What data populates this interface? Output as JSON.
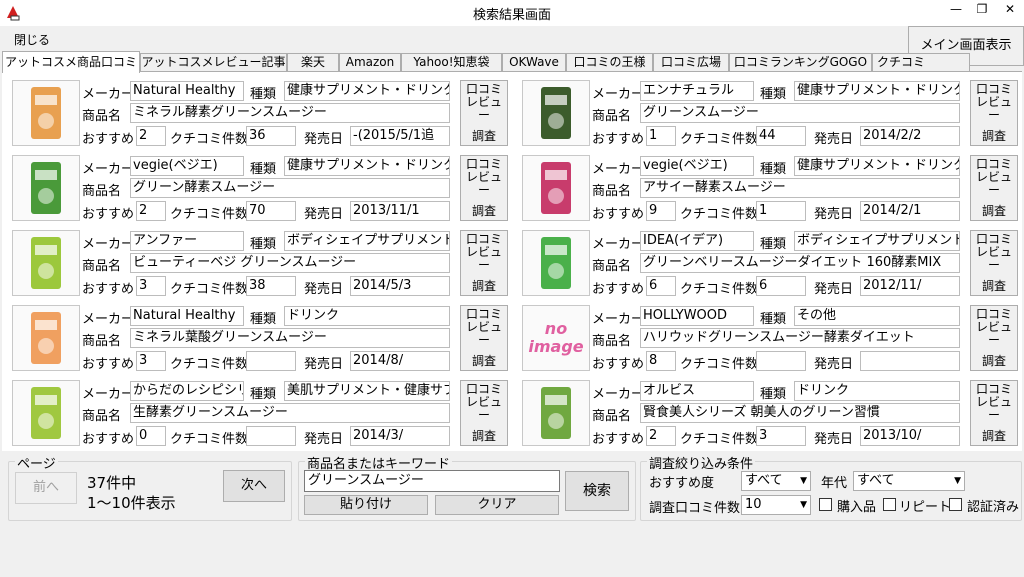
{
  "window": {
    "title": "検索結果画面"
  },
  "menu": {
    "close": "閉じる"
  },
  "main_screen_button": "メイン画面表示",
  "tabs": [
    "アットコスメ商品口コミ",
    "アットコスメレビュー記事",
    "楽天",
    "Amazon",
    "Yahoo!知恵袋",
    "OKWave",
    "口コミの王様",
    "口コミ広場",
    "口コミランキングGOGO",
    "クチコミ"
  ],
  "labels": {
    "maker": "メーカー",
    "kind": "種類",
    "product": "商品名",
    "recommend": "おすすめ",
    "review_count": "クチコミ件数",
    "release": "発売日",
    "review_btn_label": "口コミ\nレビュ\nー",
    "survey": "調査"
  },
  "products": [
    {
      "maker": "Natural Healthy",
      "kind": "健康サプリメント・ドリンク",
      "name": "ミネラル酵素グリーンスムージー",
      "recommend": "2",
      "reviews": "36",
      "release": "-(2015/5/1追",
      "img_color": "#e8a050",
      "no_image": false
    },
    {
      "maker": "エンナチュラル",
      "kind": "健康サプリメント・ドリンク",
      "name": "グリーンスムージー",
      "recommend": "1",
      "reviews": "44",
      "release": "2014/2/2",
      "img_color": "#3c5c2c",
      "no_image": false
    },
    {
      "maker": "vegie(ベジエ)",
      "kind": "健康サプリメント・ドリンク",
      "name": "グリーン酵素スムージー",
      "recommend": "2",
      "reviews": "70",
      "release": "2013/11/1",
      "img_color": "#4a9a3a",
      "no_image": false
    },
    {
      "maker": "vegie(ベジエ)",
      "kind": "健康サプリメント・ドリンク",
      "name": "アサイー酵素スムージー",
      "recommend": "9",
      "reviews": "1",
      "release": "2014/2/1",
      "img_color": "#c83c6c",
      "no_image": false
    },
    {
      "maker": "アンファー",
      "kind": "ボディシェイプサプリメント・ド",
      "name": "ビューティーベジ グリーンスムージー",
      "recommend": "3",
      "reviews": "38",
      "release": "2014/5/3",
      "img_color": "#9cc83c",
      "no_image": false
    },
    {
      "maker": "IDEA(イデア)",
      "kind": "ボディシェイプサプリメント・ド",
      "name": "グリーンベリースムージーダイエット 160酵素MIX",
      "recommend": "6",
      "reviews": "6",
      "release": "2012/11/",
      "img_color": "#4ab04a",
      "no_image": false
    },
    {
      "maker": "Natural Healthy",
      "kind": "ドリンク",
      "name": "ミネラル葉酸グリーンスムージー",
      "recommend": "3",
      "reviews": "",
      "release": "2014/8/",
      "img_color": "#f0a060",
      "no_image": false
    },
    {
      "maker": "HOLLYWOOD",
      "kind": "その他",
      "name": "ハリウッドグリーンスムージー酵素ダイエット",
      "recommend": "8",
      "reviews": "",
      "release": "",
      "img_color": "#e060a0",
      "no_image": true,
      "no_image_text": "no\nimage"
    },
    {
      "maker": "からだのレシピシリ",
      "kind": "美肌サプリメント・健康サプ",
      "name": "生酵素グリーンスムージー",
      "recommend": "0",
      "reviews": "",
      "release": "2014/3/",
      "img_color": "#a0c840",
      "no_image": false
    },
    {
      "maker": "オルビス",
      "kind": "ドリンク",
      "name": "賢食美人シリーズ 朝美人のグリーン習慣",
      "recommend": "2",
      "reviews": "3",
      "release": "2013/10/",
      "img_color": "#70a840",
      "no_image": false
    }
  ],
  "page": {
    "group_title": "ページ",
    "prev": "前へ",
    "next": "次へ",
    "total": "37件中",
    "range": "1〜10件表示"
  },
  "keyword": {
    "group_title": "商品名またはキーワード",
    "value": "グリーンスムージー",
    "paste": "貼り付け",
    "clear": "クリア",
    "search": "検索"
  },
  "filter": {
    "group_title": "調査絞り込み条件",
    "recommend_label": "おすすめ度",
    "recommend_value": "すべて",
    "age_label": "年代",
    "age_value": "すべて",
    "count_label": "調査口コミ件数",
    "count_value": "10",
    "purchase": "購入品",
    "repeat": "リピート",
    "verified": "認証済み"
  }
}
